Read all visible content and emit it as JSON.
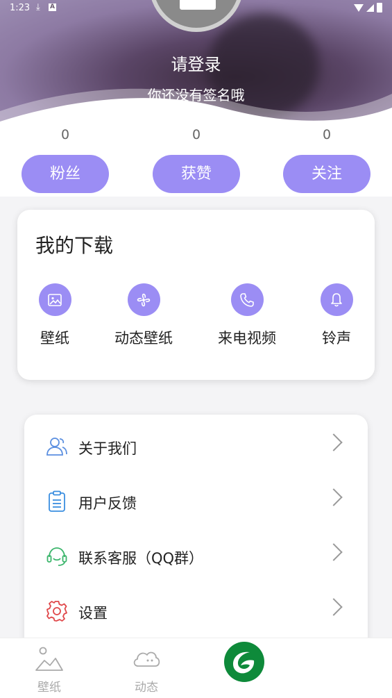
{
  "status": {
    "time": "1:23"
  },
  "profile": {
    "login": "请登录",
    "signature": "你还没有签名哦"
  },
  "stats": [
    {
      "count": "0",
      "label": "粉丝"
    },
    {
      "count": "0",
      "label": "获赞"
    },
    {
      "count": "0",
      "label": "关注"
    }
  ],
  "downloads": {
    "title": "我的下载",
    "items": [
      {
        "label": "壁纸",
        "icon": "image-icon"
      },
      {
        "label": "动态壁纸",
        "icon": "fan-icon"
      },
      {
        "label": "来电视频",
        "icon": "phone-icon"
      },
      {
        "label": "铃声",
        "icon": "bell-icon"
      }
    ]
  },
  "menu": [
    {
      "label": "关于我们",
      "icon": "users-icon"
    },
    {
      "label": "用户反馈",
      "icon": "clipboard-icon"
    },
    {
      "label": "联系客服（QQ群）",
      "icon": "headset-icon"
    },
    {
      "label": "设置",
      "icon": "gear-icon"
    }
  ],
  "tabs": [
    {
      "label": "壁纸",
      "icon": "landscape-icon"
    },
    {
      "label": "动态",
      "icon": "cloud-icon"
    },
    {
      "label": "",
      "icon": "app-logo-icon"
    }
  ],
  "colors": {
    "accent": "#9b8df4",
    "header": "#8d7aa3"
  }
}
